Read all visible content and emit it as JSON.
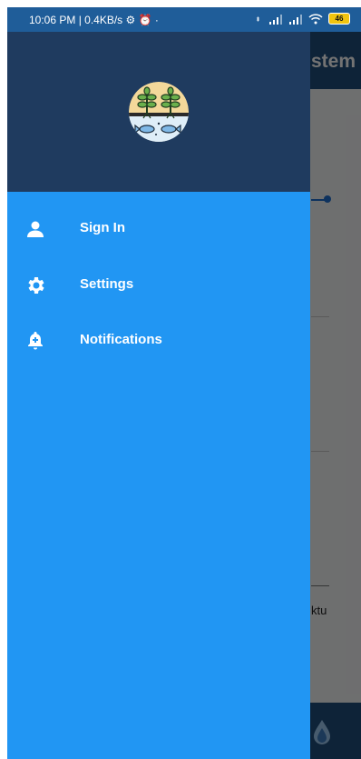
{
  "status_bar": {
    "left_text": "10:06 PM | 0.4KB/s ⚙ ⏰ ·",
    "battery": "46"
  },
  "background_app": {
    "title_partial": "stem",
    "label_partial": "ktu"
  },
  "drawer": {
    "logo_icon": "plants-and-fish-logo",
    "items": [
      {
        "label": "Sign In",
        "icon": "person-icon"
      },
      {
        "label": "Settings",
        "icon": "gear-icon"
      },
      {
        "label": "Notifications",
        "icon": "bell-plus-icon"
      }
    ]
  },
  "colors": {
    "drawer_header": "#1f3b5f",
    "drawer_body": "#2196f3",
    "status_bar": "#1f5d99",
    "app_bar": "#1f4f7d"
  }
}
